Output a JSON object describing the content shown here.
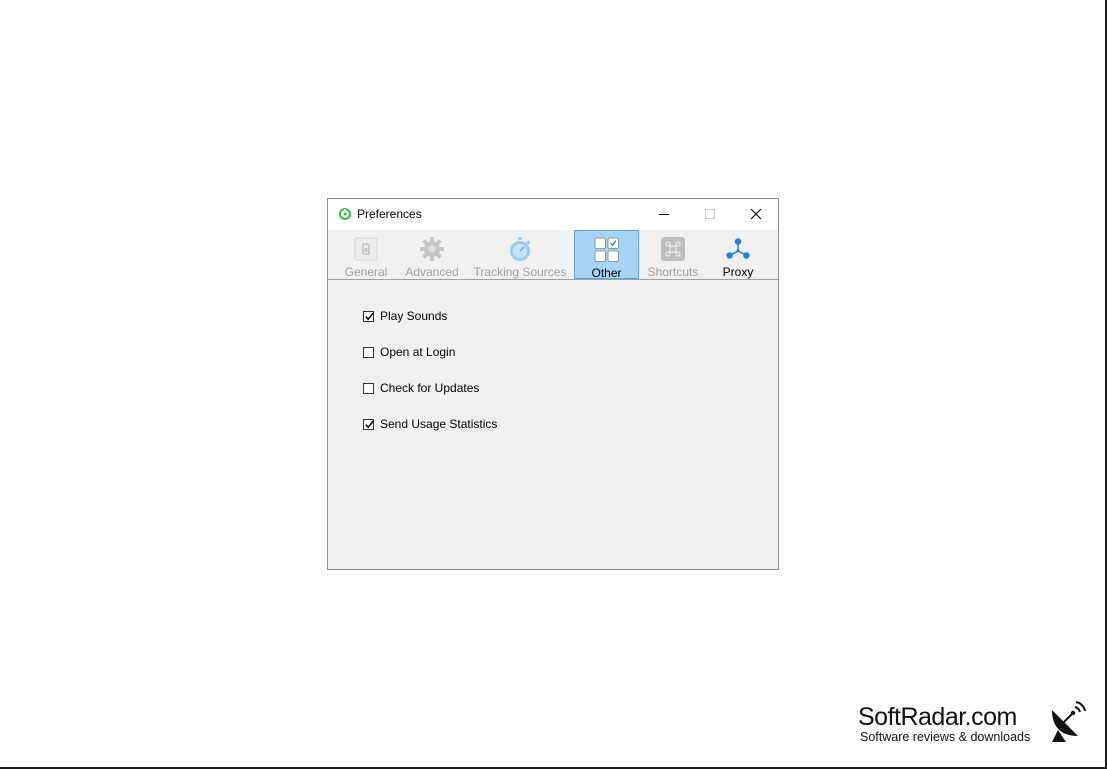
{
  "window": {
    "title": "Preferences",
    "controls": {
      "minimize": "minimize",
      "maximize": "maximize",
      "close": "close"
    }
  },
  "toolbar": {
    "tabs": [
      {
        "label": "General",
        "icon": "general-icon",
        "state": "disabled"
      },
      {
        "label": "Advanced",
        "icon": "gear-icon",
        "state": "disabled"
      },
      {
        "label": "Tracking Sources",
        "icon": "stopwatch-icon",
        "state": "disabled"
      },
      {
        "label": "Other",
        "icon": "grid-check-icon",
        "state": "active"
      },
      {
        "label": "Shortcuts",
        "icon": "command-key-icon",
        "state": "disabled"
      },
      {
        "label": "Proxy",
        "icon": "network-icon",
        "state": "enabled"
      }
    ]
  },
  "options": [
    {
      "label": "Play Sounds",
      "checked": true
    },
    {
      "label": "Open at Login",
      "checked": false
    },
    {
      "label": "Check for Updates",
      "checked": false
    },
    {
      "label": "Send Usage Statistics",
      "checked": true
    }
  ],
  "watermark": {
    "title": "SoftRadar.com",
    "subtitle": "Software reviews & downloads"
  },
  "colors": {
    "active_tab_bg": "#a6d4f7",
    "active_tab_border": "#5aa4e0",
    "disabled_text": "#a0a0a0",
    "window_bg": "#f0f0f0",
    "proxy_blue": "#2b7fd8",
    "app_icon_green": "#3bb54a"
  }
}
